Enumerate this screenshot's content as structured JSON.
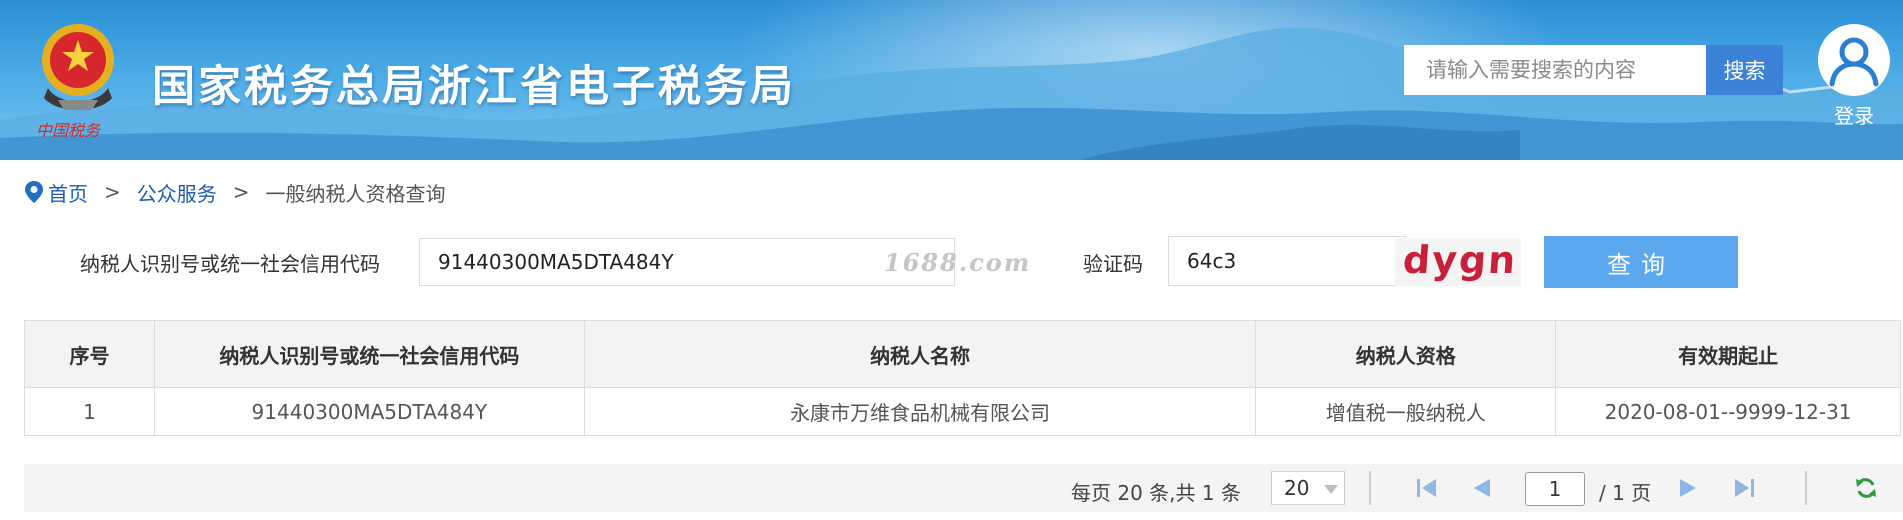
{
  "header": {
    "emblem_text": "中国税务",
    "site_title": "国家税务总局浙江省电子税务局",
    "search_placeholder": "请输入需要搜索的内容",
    "search_button": "搜索",
    "login_label": "登录"
  },
  "breadcrumb": {
    "home": "首页",
    "separator": ">",
    "section": "公众服务",
    "current": "一般纳税人资格查询"
  },
  "form": {
    "taxpayer_id_label": "纳税人识别号或统一社会信用代码",
    "taxpayer_id_value": "91440300MA5DTA484Y",
    "watermark": "1688.com",
    "captcha_label": "验证码",
    "captcha_value": "64c3",
    "captcha_image_text": "dygn",
    "query_button": "查询"
  },
  "table": {
    "headers": [
      "序号",
      "纳税人识别号或统一社会信用代码",
      "纳税人名称",
      "纳税人资格",
      "有效期起止"
    ],
    "rows": [
      [
        "1",
        "91440300MA5DTA484Y",
        "永康市万维食品机械有限公司",
        "增值税一般纳税人",
        "2020-08-01--9999-12-31"
      ]
    ]
  },
  "pagination": {
    "summary": "每页 20 条,共 1 条",
    "page_size": "20",
    "current_page": "1",
    "total_pages": "/ 1 页"
  },
  "colors": {
    "header_blue": "#2a8fd6",
    "search_button": "#3b82d8",
    "query_button": "#5ba8ef",
    "link": "#1e5ca8",
    "captcha_red": "#c8203a"
  },
  "icons": [
    "location-pin-icon",
    "user-icon",
    "first-page-icon",
    "prev-page-icon",
    "next-page-icon",
    "last-page-icon",
    "refresh-icon"
  ]
}
